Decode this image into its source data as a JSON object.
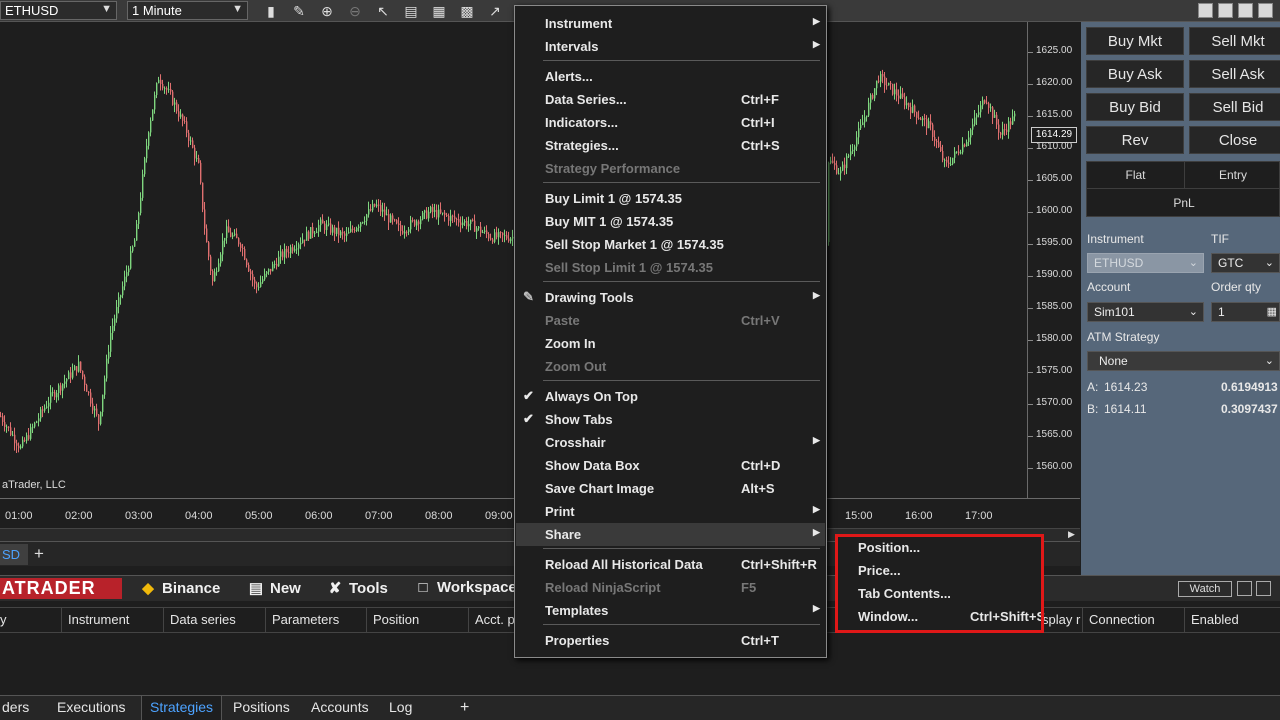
{
  "toolbar": {
    "instrument": "ETHUSD",
    "interval": "1 Minute"
  },
  "chart": {
    "price_ticks": [
      "1625.00",
      "1620.00",
      "1615.00",
      "1610.00",
      "1605.00",
      "1600.00",
      "1595.00",
      "1590.00",
      "1585.00",
      "1580.00",
      "1575.00",
      "1570.00",
      "1565.00",
      "1560.00"
    ],
    "time_ticks": [
      "01:00",
      "02:00",
      "03:00",
      "04:00",
      "05:00",
      "06:00",
      "07:00",
      "08:00",
      "09:00",
      "15:00",
      "16:00",
      "17:00"
    ],
    "last_price": "1614.29",
    "watermark": "aTrader, LLC",
    "tab_label": "SD",
    "add_tab": "+",
    "colors": {
      "up": "#7fd67f",
      "down": "#e07070",
      "background": "#1e1e1e"
    }
  },
  "order_panel": {
    "buttons": [
      "Buy Mkt",
      "Sell Mkt",
      "Buy Ask",
      "Sell Ask",
      "Buy Bid",
      "Sell Bid",
      "Rev",
      "Close"
    ],
    "flat": "Flat",
    "entry": "Entry",
    "pnl": "PnL",
    "instrument_label": "Instrument",
    "instrument_value": "ETHUSD",
    "tif_label": "TIF",
    "tif_value": "GTC",
    "account_label": "Account",
    "account_value": "Sim101",
    "qty_label": "Order qty",
    "qty_value": "1",
    "atm_label": "ATM Strategy",
    "atm_value": "None",
    "ask_label": "A:",
    "ask_price": "1614.23",
    "ask_size": "0.6194913",
    "bid_label": "B:",
    "bid_price": "1614.11",
    "bid_size": "0.3097437"
  },
  "control_center": {
    "logo": "ATRADER",
    "menu": [
      "Binance",
      "New",
      "Tools",
      "Workspace"
    ],
    "watch": "Watch",
    "columns": [
      "y",
      "Instrument",
      "Data series",
      "Parameters",
      "Position",
      "Acct. po",
      "splay r",
      "Connection",
      "Enabled"
    ],
    "tabs": [
      "ders",
      "Executions",
      "Strategies",
      "Positions",
      "Accounts",
      "Log",
      "+"
    ],
    "active_tab": "Strategies"
  },
  "context_menu": {
    "items": [
      {
        "label": "Instrument",
        "submenu": true
      },
      {
        "label": "Intervals",
        "submenu": true
      },
      {
        "label": "Alerts..."
      },
      {
        "label": "Data Series...",
        "shortcut": "Ctrl+F"
      },
      {
        "label": "Indicators...",
        "shortcut": "Ctrl+I"
      },
      {
        "label": "Strategies...",
        "shortcut": "Ctrl+S"
      },
      {
        "label": "Strategy Performance",
        "disabled": true
      },
      {
        "label": "Buy Limit 1 @ 1574.35"
      },
      {
        "label": "Buy MIT 1 @ 1574.35"
      },
      {
        "label": "Sell Stop Market 1 @ 1574.35"
      },
      {
        "label": "Sell Stop Limit 1 @ 1574.35",
        "disabled": true
      },
      {
        "label": "Drawing Tools",
        "submenu": true,
        "icon": "pencil-icon"
      },
      {
        "label": "Paste",
        "shortcut": "Ctrl+V",
        "disabled": true
      },
      {
        "label": "Zoom In"
      },
      {
        "label": "Zoom Out",
        "disabled": true
      },
      {
        "label": "Always On Top",
        "checked": true
      },
      {
        "label": "Show Tabs",
        "checked": true
      },
      {
        "label": "Crosshair",
        "submenu": true
      },
      {
        "label": "Show Data Box",
        "shortcut": "Ctrl+D"
      },
      {
        "label": "Save Chart Image",
        "shortcut": "Alt+S"
      },
      {
        "label": "Print",
        "submenu": true
      },
      {
        "label": "Share",
        "submenu": true,
        "highlighted": true
      },
      {
        "label": "Reload All Historical Data",
        "shortcut": "Ctrl+Shift+R"
      },
      {
        "label": "Reload NinjaScript",
        "shortcut": "F5",
        "disabled": true
      },
      {
        "label": "Templates",
        "submenu": true
      },
      {
        "label": "Properties",
        "shortcut": "Ctrl+T"
      }
    ]
  },
  "share_submenu": {
    "items": [
      {
        "label": "Position..."
      },
      {
        "label": "Price..."
      },
      {
        "label": "Tab Contents..."
      },
      {
        "label": "Window...",
        "shortcut": "Ctrl+Shift+S"
      }
    ],
    "outline_color": "#e01818"
  }
}
